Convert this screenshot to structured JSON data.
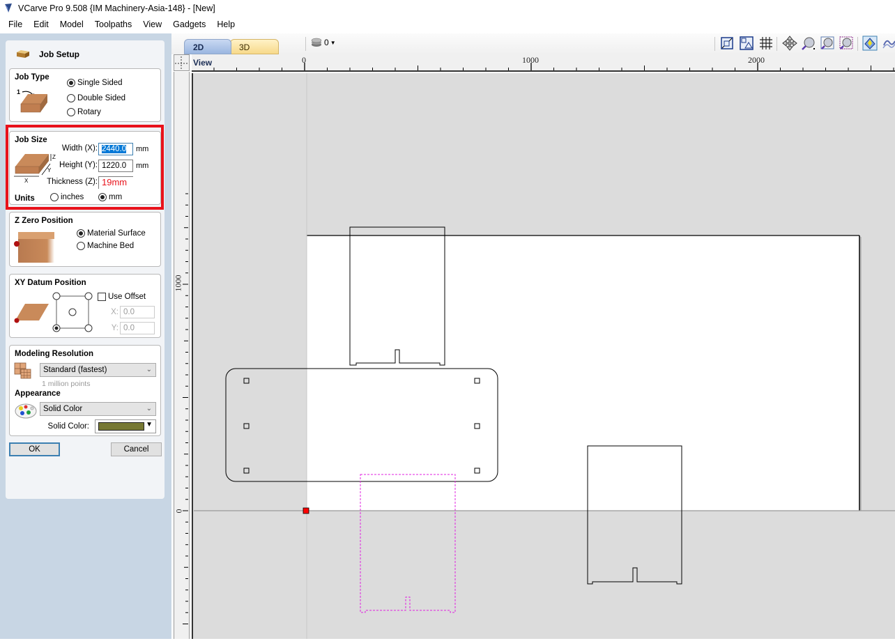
{
  "window": {
    "title": "VCarve Pro 9.508 {IM Machinery-Asia-148} - [New]"
  },
  "menu": [
    "File",
    "Edit",
    "Model",
    "Toolpaths",
    "View",
    "Gadgets",
    "Help"
  ],
  "panel": {
    "title": "Job Setup",
    "job_type": {
      "title": "Job Type",
      "options": [
        "Single Sided",
        "Double Sided",
        "Rotary"
      ],
      "selected": "Single Sided"
    },
    "job_size": {
      "title": "Job Size",
      "width_label": "Width (X):",
      "width_value": "2440.0",
      "height_label": "Height (Y):",
      "height_value": "1220.0",
      "thickness_label": "Thickness (Z):",
      "thickness_value": "19mm",
      "unit": "mm",
      "units_label": "Units",
      "unit_options": [
        "inches",
        "mm"
      ],
      "unit_selected": "mm",
      "diagram_labels": {
        "x": "X",
        "y": "Y",
        "z": "Z"
      }
    },
    "z_zero": {
      "title": "Z Zero Position",
      "options": [
        "Material Surface",
        "Machine Bed"
      ],
      "selected": "Material Surface"
    },
    "xy_datum": {
      "title": "XY Datum Position",
      "use_offset_label": "Use Offset",
      "use_offset_checked": false,
      "x_label": "X:",
      "x_value": "0.0",
      "y_label": "Y:",
      "y_value": "0.0",
      "selected_corner": "bottom-left"
    },
    "modeling": {
      "title": "Modeling Resolution",
      "resolution_value": "Standard (fastest)",
      "resolution_note": "1 million points",
      "appearance_title": "Appearance",
      "appearance_value": "Solid Color",
      "solid_color_label": "Solid Color:",
      "solid_color": "#767833"
    },
    "ok_label": "OK",
    "cancel_label": "Cancel"
  },
  "view": {
    "tabs": [
      "2D View",
      "3D View"
    ],
    "active_tab": "2D View",
    "layer_value": "0",
    "toolbar_icons": [
      "zoom-extents-icon",
      "zoom-material-icon",
      "grid-icon",
      "pan-icon",
      "zoom-in-icon",
      "zoom-box-icon",
      "zoom-selection-icon",
      "snap-icon",
      "toolpath-preview-icon"
    ]
  },
  "rulers": {
    "horizontal_labels": [
      "0",
      "1000",
      "2000"
    ],
    "vertical_labels": [
      "1000",
      "0"
    ]
  },
  "colors": {
    "highlight_red": "#e8121b",
    "selection_magenta": "#e020e0",
    "origin_marker": "#ff0000"
  }
}
